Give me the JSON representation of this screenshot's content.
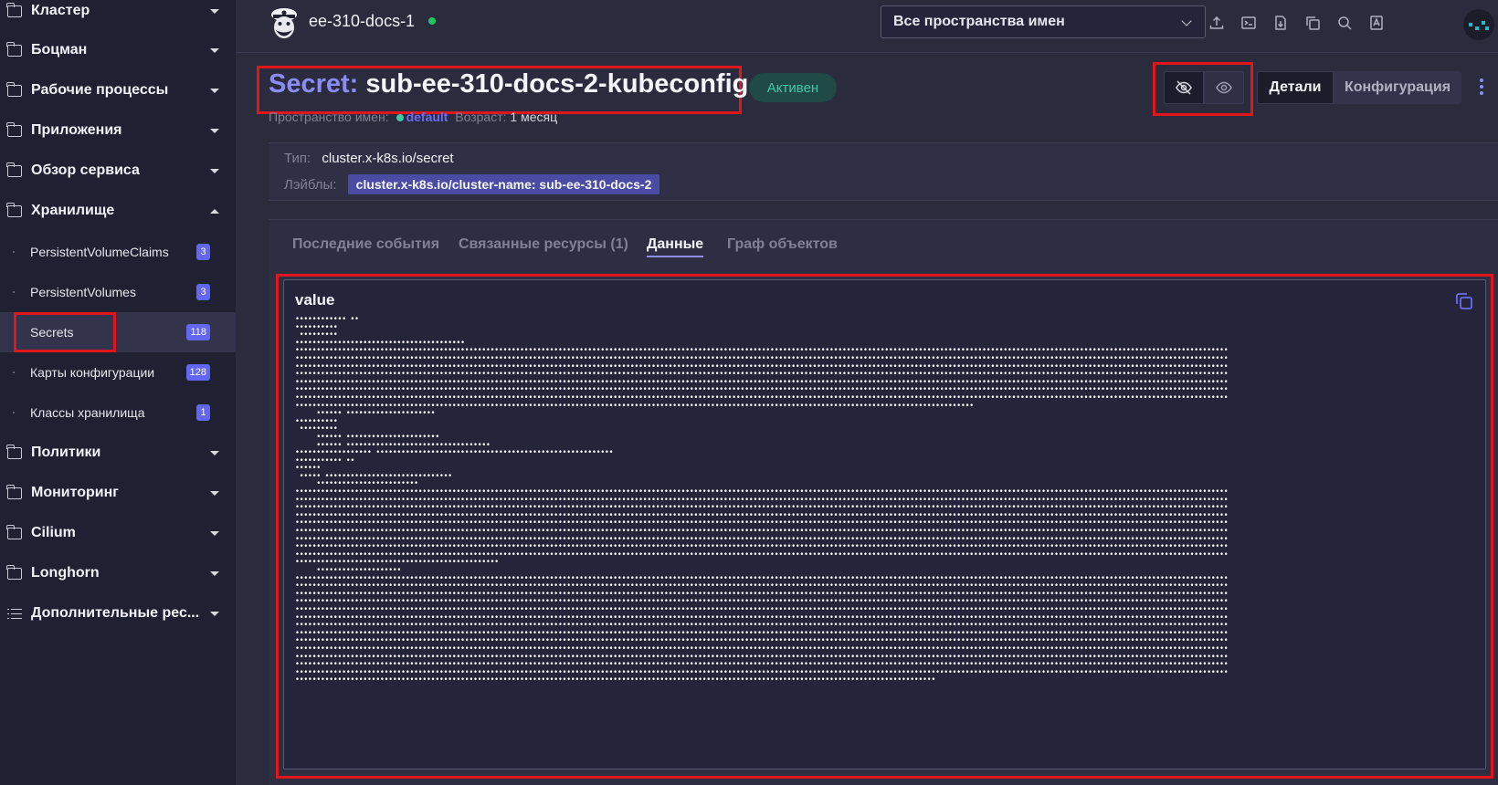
{
  "sidebar": {
    "groups_top": [
      {
        "label": "Кластер"
      },
      {
        "label": "Боцман"
      },
      {
        "label": "Рабочие процессы"
      },
      {
        "label": "Приложения"
      },
      {
        "label": "Обзор сервиса"
      }
    ],
    "storage": {
      "label": "Хранилище",
      "items": [
        {
          "label": "PersistentVolumeClaims",
          "count": "3"
        },
        {
          "label": "PersistentVolumes",
          "count": "3"
        },
        {
          "label": "Secrets",
          "count": "118"
        },
        {
          "label": "Карты конфигурации",
          "count": "128"
        },
        {
          "label": "Классы хранилища",
          "count": "1"
        }
      ]
    },
    "groups_bottom": [
      {
        "label": "Политики"
      },
      {
        "label": "Мониторинг"
      },
      {
        "label": "Cilium"
      },
      {
        "label": "Longhorn"
      },
      {
        "label": "Дополнительные рес..."
      }
    ]
  },
  "header": {
    "cluster_name": "ee-310-docs-1",
    "namespace_select": "Все пространства имен",
    "icons": [
      "upload-icon",
      "terminal-icon",
      "download-icon",
      "copy-icon",
      "search-icon",
      "document-icon"
    ]
  },
  "resource": {
    "kind": "Secret:",
    "name": "sub-ee-310-docs-2-kubeconfig",
    "status": "Активен",
    "namespace_label": "Пространство имен:",
    "namespace": "default",
    "age_label": "Возраст:",
    "age": "1 месяц",
    "type_label": "Тип:",
    "type": "cluster.x-k8s.io/secret",
    "labels_label": "Лэйблы:",
    "label_chip": "cluster.x-k8s.io/cluster-name: sub-ee-310-docs-2"
  },
  "view_tabs": {
    "details": "Детали",
    "config": "Конфигурация"
  },
  "tabs": [
    "Последние события",
    "Связанные ресурсы (1)",
    "Данные",
    "Граф объектов"
  ],
  "active_tab": "Данные",
  "data": {
    "key": "value"
  },
  "colors": {
    "accent": "#8b8cf8",
    "highlight_border": "#e0161c",
    "status_text": "#41c9a6",
    "badge": "#6366f1"
  }
}
